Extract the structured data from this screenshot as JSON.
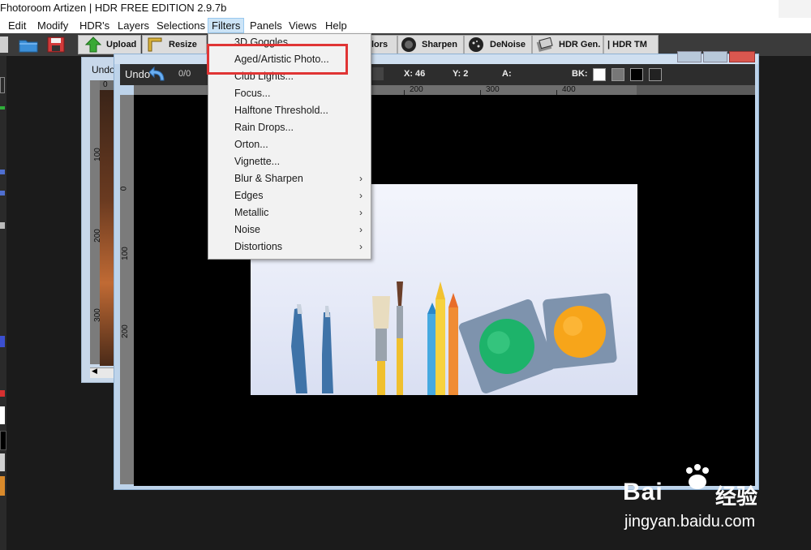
{
  "window": {
    "title": "Fhotoroom Artizen | HDR FREE EDITION 2.9.7b"
  },
  "menubar": {
    "items": [
      {
        "label": "Edit"
      },
      {
        "label": "Modify"
      },
      {
        "label": "HDR's"
      },
      {
        "label": "Layers"
      },
      {
        "label": "Selections"
      },
      {
        "label": "Filters"
      },
      {
        "label": "Panels"
      },
      {
        "label": "Views"
      },
      {
        "label": "Help"
      }
    ]
  },
  "toolbar": {
    "upload": "Upload",
    "resize": "Resize",
    "colors_partial": "lors",
    "sharpen": "Sharpen",
    "denoise": "DeNoise",
    "hdr_gen": "HDR Gen.",
    "hdr_tm": "| HDR TM"
  },
  "back_window": {
    "title": "Undo",
    "ruler_labels": [
      "0",
      "100",
      "200",
      "300"
    ]
  },
  "editor": {
    "undo_label": "Undo",
    "undo_count": "0/0",
    "coord_x": "X: 46",
    "coord_y": "Y: 2",
    "alpha": "A:",
    "bk_label": "BK:",
    "ruler_top_labels": [
      "200",
      "300",
      "400"
    ],
    "ruler_left_labels": [
      "0",
      "100",
      "200"
    ],
    "bk_swatches": [
      "#ffffff",
      "#777777",
      "#000000",
      "#222222"
    ]
  },
  "filters_menu": {
    "items": [
      {
        "label": "3D Goggles",
        "submenu": false
      },
      {
        "label": "Aged/Artistic Photo...",
        "submenu": false
      },
      {
        "label": "Club Lights...",
        "submenu": false
      },
      {
        "label": "Focus...",
        "submenu": false
      },
      {
        "label": "Halftone Threshold...",
        "submenu": false
      },
      {
        "label": "Rain Drops...",
        "submenu": false
      },
      {
        "label": "Orton...",
        "submenu": false
      },
      {
        "label": "Vignette...",
        "submenu": false
      },
      {
        "label": "Blur & Sharpen",
        "submenu": true
      },
      {
        "label": "Edges",
        "submenu": true
      },
      {
        "label": "Metallic",
        "submenu": true
      },
      {
        "label": "Noise",
        "submenu": true
      },
      {
        "label": "Distortions",
        "submenu": true
      }
    ],
    "submenu_arrow": "›"
  },
  "watermark": {
    "brand": "Bai",
    "brand2": "经验",
    "url": "jingyan.baidu.com"
  },
  "colors": {
    "highlight": "#e03535",
    "menu_active": "#cce4f7",
    "upload_arrow": "#3aa935",
    "paint_green": "#1db36a",
    "paint_orange": "#f7a51a"
  }
}
